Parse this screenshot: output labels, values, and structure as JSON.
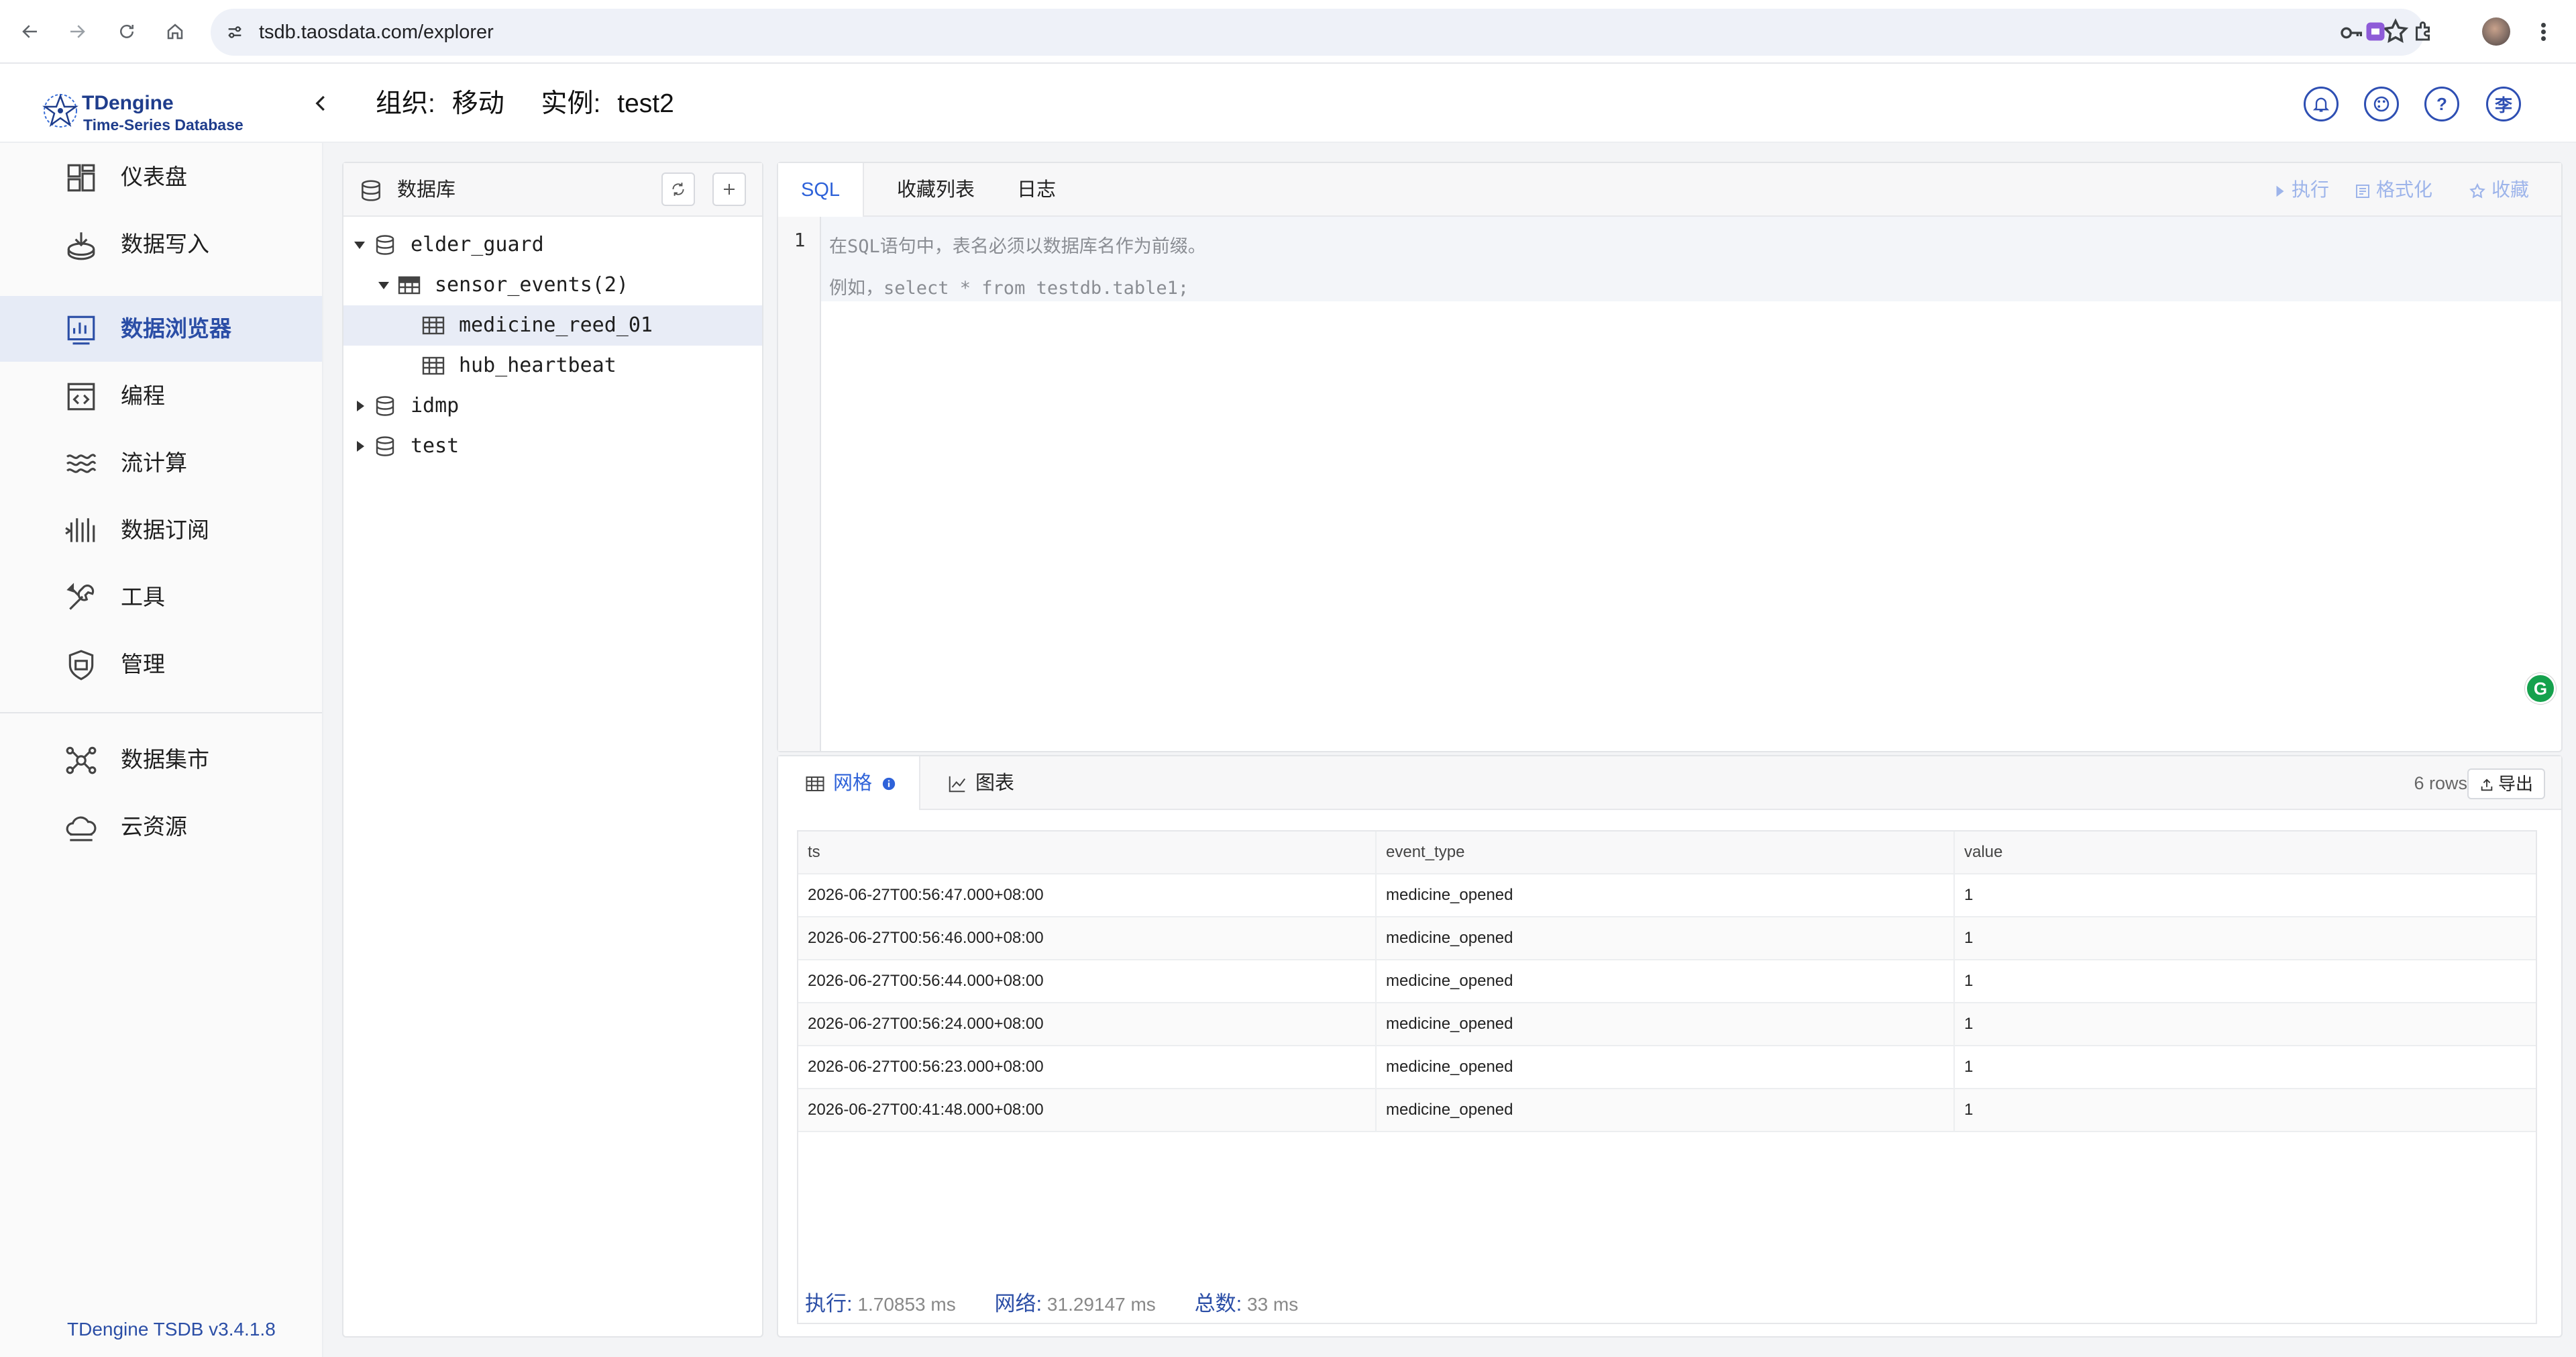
{
  "browser": {
    "url": "tsdb.taosdata.com/explorer"
  },
  "header": {
    "logo_title": "TDengine",
    "logo_subtitle": "Time-Series Database",
    "org_label": "组织:",
    "org_value": "移动",
    "instance_label": "实例:",
    "instance_value": "test2",
    "user_initial": "李"
  },
  "sidebar": {
    "items": [
      {
        "label": "仪表盘",
        "icon": "dashboard-icon"
      },
      {
        "label": "数据写入",
        "icon": "data-in-icon"
      },
      {
        "label": "数据浏览器",
        "icon": "explorer-icon",
        "active": true
      },
      {
        "label": "编程",
        "icon": "code-icon"
      },
      {
        "label": "流计算",
        "icon": "stream-icon"
      },
      {
        "label": "数据订阅",
        "icon": "subscribe-icon"
      },
      {
        "label": "工具",
        "icon": "tools-icon"
      },
      {
        "label": "管理",
        "icon": "management-icon"
      }
    ],
    "items2": [
      {
        "label": "数据集市",
        "icon": "marketplace-icon"
      },
      {
        "label": "云资源",
        "icon": "cloud-icon"
      }
    ],
    "version": "TDengine TSDB v3.4.1.8"
  },
  "db_panel": {
    "title": "数据库",
    "tree": [
      {
        "label": "elder_guard",
        "type": "database",
        "expanded": true
      },
      {
        "label": "sensor_events(2)",
        "type": "stable",
        "expanded": true
      },
      {
        "label": "medicine_reed_01",
        "type": "table",
        "selected": true
      },
      {
        "label": "hub_heartbeat",
        "type": "table"
      },
      {
        "label": "idmp",
        "type": "database",
        "expanded": false
      },
      {
        "label": "test",
        "type": "database",
        "expanded": false
      }
    ]
  },
  "editor": {
    "tabs": [
      "SQL",
      "收藏列表",
      "日志"
    ],
    "active_tab": "SQL",
    "actions": {
      "run": "执行",
      "format": "格式化",
      "favorite": "收藏"
    },
    "line_number": "1",
    "placeholder_line1": "在SQL语句中，表名必须以数据库名作为前缀。",
    "placeholder_line2": "例如，select * from testdb.table1;"
  },
  "result": {
    "tabs": {
      "grid": "网格",
      "chart": "图表"
    },
    "rows_count": "6 rows",
    "export_label": "导出",
    "columns": [
      "ts",
      "event_type",
      "value"
    ],
    "rows": [
      [
        "2026-06-27T00:56:47.000+08:00",
        "medicine_opened",
        "1"
      ],
      [
        "2026-06-27T00:56:46.000+08:00",
        "medicine_opened",
        "1"
      ],
      [
        "2026-06-27T00:56:44.000+08:00",
        "medicine_opened",
        "1"
      ],
      [
        "2026-06-27T00:56:24.000+08:00",
        "medicine_opened",
        "1"
      ],
      [
        "2026-06-27T00:56:23.000+08:00",
        "medicine_opened",
        "1"
      ],
      [
        "2026-06-27T00:41:48.000+08:00",
        "medicine_opened",
        "1"
      ]
    ],
    "stats": {
      "exec_label": "执行:",
      "exec_value": "1.70853 ms",
      "net_label": "网络:",
      "net_value": "31.29147 ms",
      "total_label": "总数:",
      "total_value": "33 ms"
    }
  },
  "colors": {
    "accent": "#2e62d9",
    "brand": "#1f3d8c",
    "active_bg": "#e6ebf6"
  }
}
